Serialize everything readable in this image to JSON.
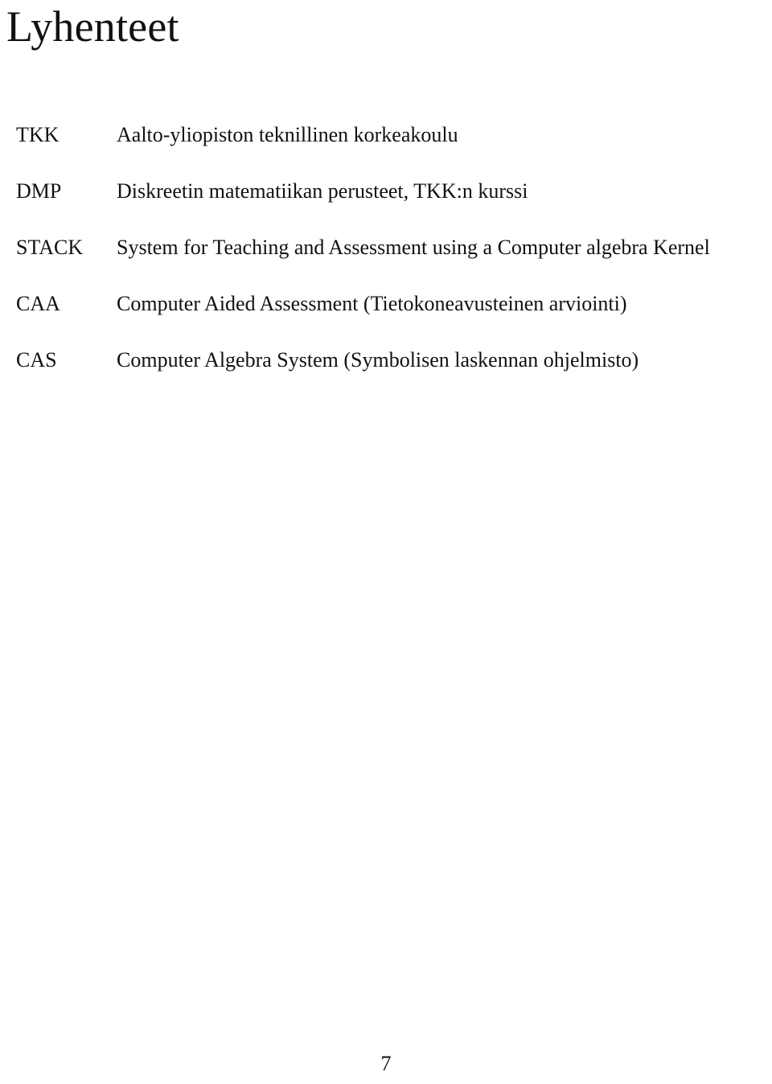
{
  "document": {
    "title": "Lyhenteet",
    "page_number": "7"
  },
  "abbreviations": [
    {
      "term": "TKK",
      "definition": "Aalto-yliopiston teknillinen korkeakoulu"
    },
    {
      "term": "DMP",
      "definition": "Diskreetin matematiikan perusteet, TKK:n kurssi"
    },
    {
      "term": "STACK",
      "definition": "System for Teaching and Assessment using a Computer algebra Kernel"
    },
    {
      "term": "CAA",
      "definition": "Computer Aided Assessment (Tietokoneavusteinen arviointi)"
    },
    {
      "term": "CAS",
      "definition": "Computer Algebra System (Symbolisen laskennan ohjelmisto)"
    }
  ]
}
